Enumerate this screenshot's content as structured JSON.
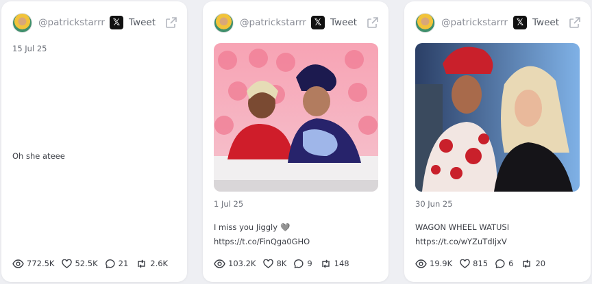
{
  "cards": [
    {
      "handle": "@patrickstarrr",
      "tweet_label": "Tweet",
      "x_glyph": "𝕏",
      "date": "15 Jul 25",
      "text": "Oh she ateee",
      "has_image": false,
      "stats": {
        "views": "772.5K",
        "likes": "52.5K",
        "replies": "21",
        "retweets": "2.6K"
      }
    },
    {
      "handle": "@patrickstarrr",
      "tweet_label": "Tweet",
      "x_glyph": "𝕏",
      "date": "1 Jul 25",
      "text_line1": "I miss you Jiggly",
      "emoji": "🩶",
      "text_line2": "https://t.co/FinQga0GHO",
      "has_image": true,
      "image_desc": "pink-stage-photo",
      "stats": {
        "views": "103.2K",
        "likes": "8K",
        "replies": "9",
        "retweets": "148"
      }
    },
    {
      "handle": "@patrickstarrr",
      "tweet_label": "Tweet",
      "x_glyph": "𝕏",
      "date": "30 Jun 25",
      "text_line1": "WAGON WHEEL WATUSI",
      "text_line2": "https://t.co/wYZuTdIjxV",
      "has_image": true,
      "image_desc": "event-photo",
      "stats": {
        "views": "19.9K",
        "likes": "815",
        "replies": "6",
        "retweets": "20"
      }
    }
  ],
  "colors": {
    "background": "#eeeff3",
    "card": "#ffffff",
    "muted": "#8a8d96",
    "x_brand": "#111111"
  },
  "icons": [
    "eye-icon",
    "heart-icon",
    "comment-icon",
    "retweet-icon",
    "external-link-icon",
    "x-logo-icon"
  ]
}
